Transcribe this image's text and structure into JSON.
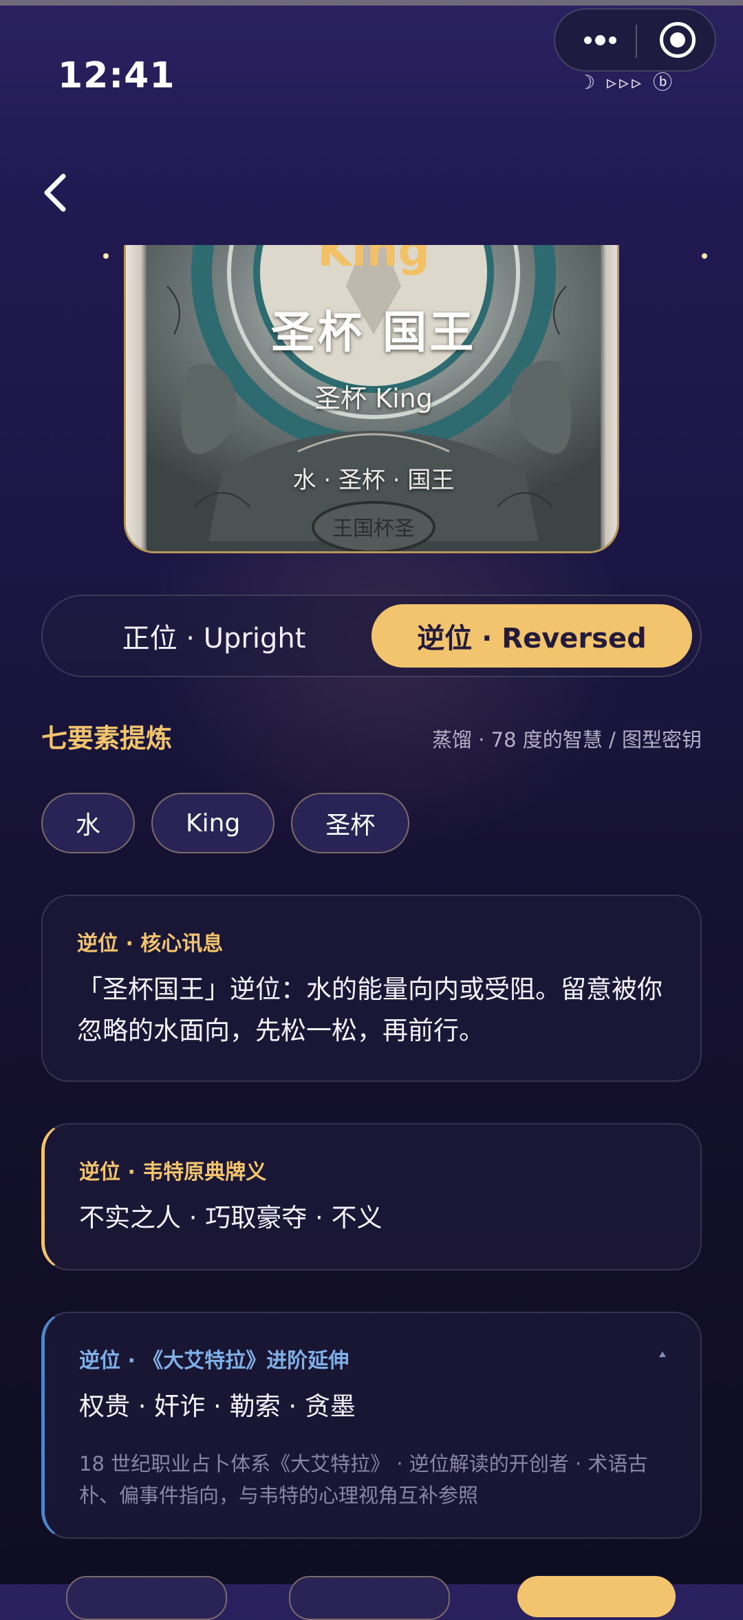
{
  "status_bar": {
    "time": "12:41",
    "icons": "☽ ▹▹▹ ⓑ"
  },
  "miniprogram_capsule": {
    "more_icon": "more-dots-icon",
    "close_icon": "target-icon"
  },
  "nav": {
    "back_icon": "chevron-left-icon"
  },
  "card": {
    "title_en": "King",
    "title_zh": "圣杯 国王",
    "subtitle": "圣杯 King",
    "tags": "水 · 圣杯 · 国王"
  },
  "orientation_toggle": {
    "upright_label": "正位 · Upright",
    "reversed_label": "逆位 · Reversed",
    "selected": "reversed"
  },
  "elements_section": {
    "title": "七要素提炼",
    "subtitle": "蒸馏 · 78 度的智慧 / 图型密钥",
    "chips": [
      "水",
      "King",
      "圣杯"
    ]
  },
  "core_message": {
    "label": "逆位 · 核心讯息",
    "body": "「圣杯国王」逆位：水的能量向内或受阻。留意被你忽略的水面向，先松一松，再前行。"
  },
  "waite_meaning": {
    "label": "逆位 · 韦特原典牌义",
    "body": "不实之人 · 巧取豪夺 · 不义"
  },
  "thoth_extension": {
    "label": "逆位 · 《大艾特拉》进阶延伸",
    "body": "权贵 · 奸诈 · 勒索 · 贪墨",
    "note": "18 世纪职业占卜体系《大艾特拉》 · 逆位解读的开创者 · 术语古朴、偏事件指向，与韦特的心理视角互补参照",
    "collapse_icon": "caret-up-icon"
  },
  "colors": {
    "accent_gold": "#f2c46d",
    "accent_blue": "#4f86c8",
    "background": "#1b1644"
  }
}
